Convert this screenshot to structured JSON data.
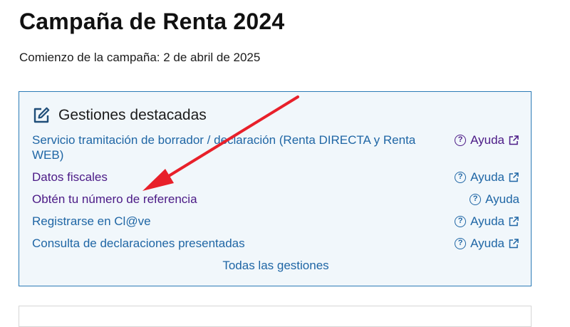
{
  "page": {
    "title": "Campaña de Renta 2024",
    "campaign_start": "Comienzo de la campaña: 2 de abril de 2025"
  },
  "colors": {
    "link_blue": "#1f66a5",
    "link_visited": "#4b1a86",
    "panel_border": "#2c7bb6",
    "panel_bg": "#f1f7fb",
    "annotation_arrow": "#e8202a"
  },
  "panel": {
    "icon": "edit-icon",
    "title": "Gestiones destacadas",
    "items": [
      {
        "label": "Servicio tramitación de borrador / declaración (Renta DIRECTA y Renta WEB)",
        "help": "Ayuda",
        "external": true,
        "visited": false
      },
      {
        "label": "Datos fiscales",
        "help": "Ayuda",
        "external": true,
        "visited": true
      },
      {
        "label": "Obtén tu número de referencia",
        "help": "Ayuda",
        "external": false,
        "visited": true
      },
      {
        "label": "Registrarse en Cl@ve",
        "help": "Ayuda",
        "external": true,
        "visited": false
      },
      {
        "label": "Consulta de declaraciones presentadas",
        "help": "Ayuda",
        "external": true,
        "visited": false
      }
    ],
    "all_link": "Todas las gestiones"
  }
}
